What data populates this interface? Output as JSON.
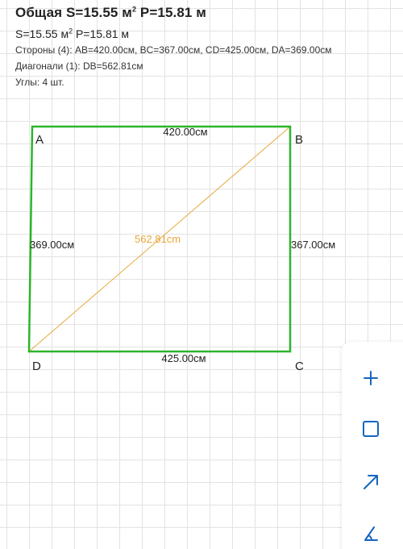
{
  "header": {
    "title_prefix": "Общая S=15.55 м",
    "title_suffix": " P=15.81 м",
    "sub_prefix": "S=15.55 м",
    "sub_suffix": " P=15.81 м",
    "area_unit_sup": "2",
    "sides": "Стороны (4): AB=420.00см, BC=367.00см, CD=425.00см, DA=369.00см",
    "diagonals": "Диагонали (1): DB=562.81см",
    "angles": "Углы: 4 шт."
  },
  "plan": {
    "vertices": {
      "A": "A",
      "B": "B",
      "C": "C",
      "D": "D"
    },
    "sides": {
      "AB": "420.00см",
      "BC": "367.00см",
      "CD": "425.00см",
      "DA": "369.00см"
    },
    "diagonal": "562.81cm",
    "outline_color": "#2bb52b",
    "diagonal_color": "#e8a83a"
  },
  "toolbar": {
    "icons": [
      "plus-icon",
      "square-icon",
      "arrow-icon",
      "angle-icon"
    ],
    "accent": "#1565c0"
  }
}
